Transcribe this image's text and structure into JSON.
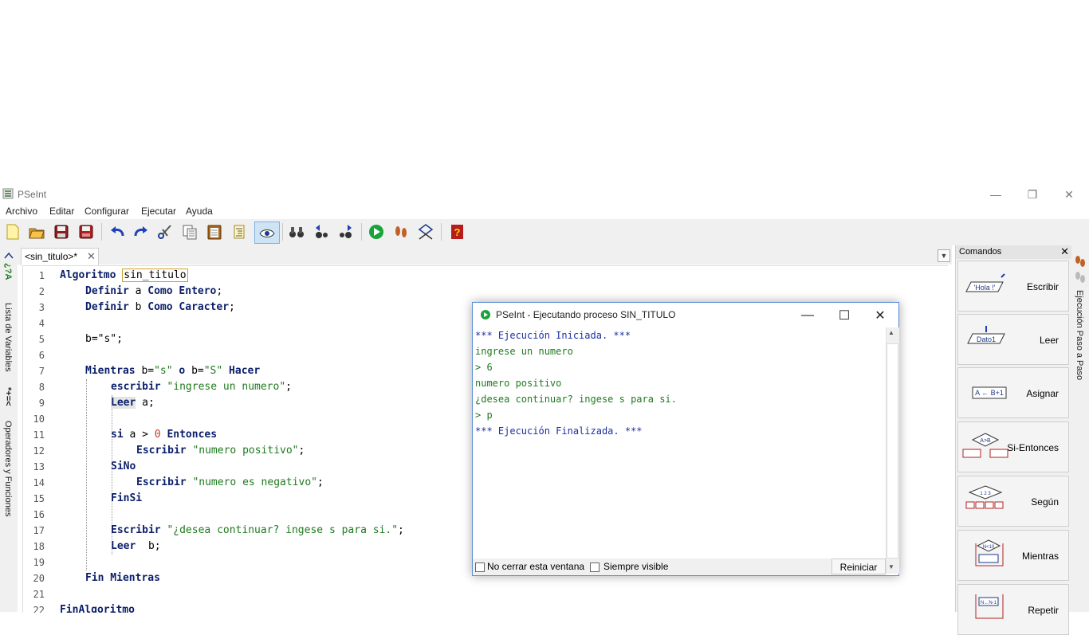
{
  "app": {
    "title": "PSeInt"
  },
  "menu": [
    "Archivo",
    "Editar",
    "Configurar",
    "Ejecutar",
    "Ayuda"
  ],
  "toolbar": {
    "buttons": [
      "new-file",
      "open-file",
      "save-file",
      "save-as",
      "undo",
      "redo",
      "cut",
      "copy",
      "paste",
      "smart-indent",
      "find",
      "find-previous",
      "find-next",
      "run",
      "step-by-step",
      "flowchart",
      "help"
    ]
  },
  "left_tabs": {
    "variables": "Lista de Variables",
    "operators": "Operadores y Funciones",
    "variables_glyphs": "*+=<",
    "symbols": "¿?A"
  },
  "editor": {
    "tab_label": "<sin_titulo>*",
    "lines": [
      {
        "n": "1"
      },
      {
        "n": "2"
      },
      {
        "n": "3"
      },
      {
        "n": "4"
      },
      {
        "n": "5"
      },
      {
        "n": "6"
      },
      {
        "n": "7"
      },
      {
        "n": "8"
      },
      {
        "n": "9"
      },
      {
        "n": "10"
      },
      {
        "n": "11"
      },
      {
        "n": "12"
      },
      {
        "n": "13"
      },
      {
        "n": "14"
      },
      {
        "n": "15"
      },
      {
        "n": "16"
      },
      {
        "n": "17"
      },
      {
        "n": "18"
      },
      {
        "n": "19"
      },
      {
        "n": "20"
      },
      {
        "n": "21"
      },
      {
        "n": "22"
      }
    ],
    "code": {
      "l1_kw": "Algoritmo",
      "l1_name": "sin_titulo",
      "l2_kw": "Definir",
      "l2_var": " a ",
      "l2_kw2": "Como Entero",
      "l2_end": ";",
      "l3_kw": "Definir",
      "l3_var": " b ",
      "l3_kw2": "Como Caracter",
      "l3_end": ";",
      "l5": "b=\"s\";",
      "l7_kw": "Mientras",
      "l7_a": " b=",
      "l7_s1": "\"s\"",
      "l7_o": " o ",
      "l7_b": "b=",
      "l7_s2": "\"S\"",
      "l7_kw2": " Hacer",
      "l8_kw": "escribir",
      "l8_str": " \"ingrese un numero\"",
      "l8_end": ";",
      "l9_kw": "Leer",
      "l9_var": " a;",
      "l11_kw": "si",
      "l11_a": " a > ",
      "l11_num": "0",
      "l11_kw2": " Entonces",
      "l12_kw": "Escribir",
      "l12_str": " \"numero positivo\"",
      "l12_end": ";",
      "l13_kw": "SiNo",
      "l14_kw": "Escribir",
      "l14_str": " \"numero es negativo\"",
      "l14_end": ";",
      "l15_kw": "FinSi",
      "l17_kw": "Escribir",
      "l17_str": " \"¿desea continuar? ingese s para si.\"",
      "l17_end": ";",
      "l18_kw": "Leer",
      "l18_var": "  b;",
      "l20_kw": "Fin Mientras",
      "l22_kw": "FinAlgoritmo"
    }
  },
  "commands": {
    "title": "Comandos",
    "items": [
      {
        "label": "Escribir",
        "glyph": "'Hola !'"
      },
      {
        "label": "Leer",
        "glyph": "Dato1"
      },
      {
        "label": "Asignar",
        "glyph": "A ← B+1"
      },
      {
        "label": "Si-Entonces",
        "glyph": "A>B"
      },
      {
        "label": "Según",
        "glyph": "1 2 3"
      },
      {
        "label": "Mientras",
        "glyph": "N<10"
      },
      {
        "label": "Repetir",
        "glyph": "N←N-1"
      }
    ]
  },
  "right_tab": {
    "label": "Ejecución Paso a Paso"
  },
  "console": {
    "title": "PSeInt - Ejecutando proceso SIN_TITULO",
    "lines": [
      {
        "text": "*** Ejecución Iniciada. ***",
        "color": "blue"
      },
      {
        "text": "ingrese un numero",
        "color": "green"
      },
      {
        "text": "> 6",
        "color": "green"
      },
      {
        "text": "numero positivo",
        "color": "green"
      },
      {
        "text": "¿desea continuar? ingese s para si.",
        "color": "green"
      },
      {
        "text": "> p",
        "color": "green"
      },
      {
        "text": "*** Ejecución Finalizada. ***",
        "color": "blue"
      }
    ],
    "keep_open_label": "No cerrar esta ventana",
    "always_visible_label": "Siempre visible",
    "restart_label": "Reiniciar"
  },
  "colors": {
    "keyword": "#0b1f6a",
    "string": "#1f7a1f",
    "number": "#c0392b",
    "console_blue": "#1c2fa3",
    "console_green": "#1f7a1f",
    "run_green": "#1aa33a"
  }
}
